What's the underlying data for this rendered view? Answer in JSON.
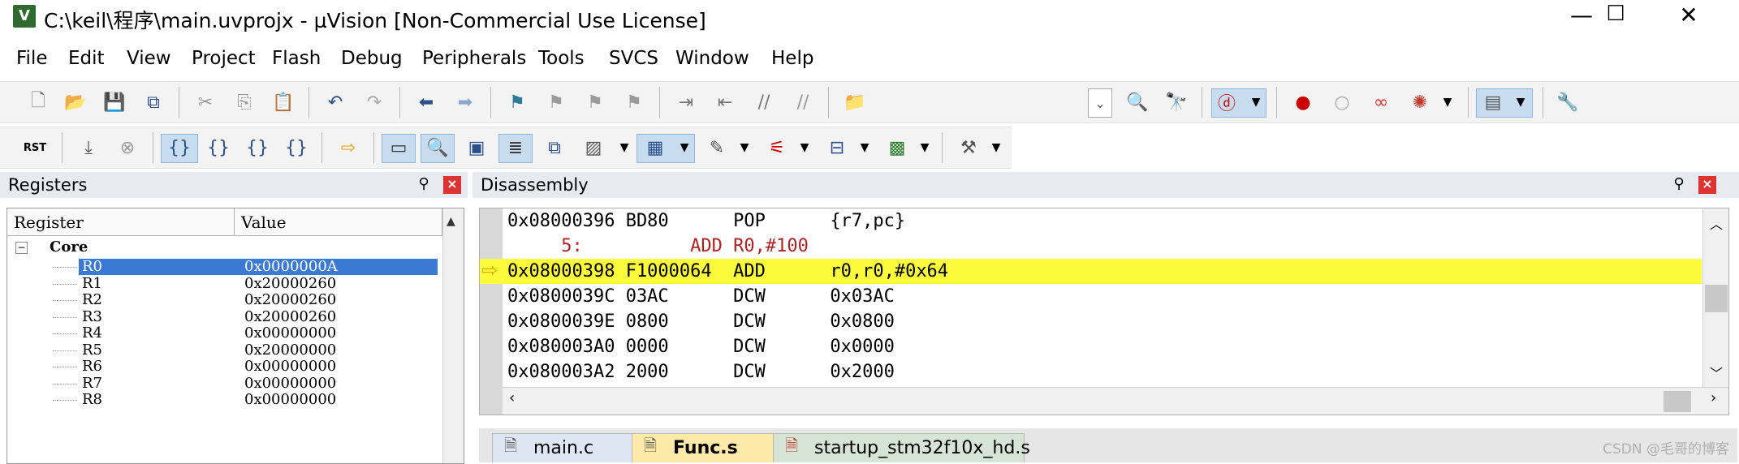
{
  "window": {
    "title": "C:\\keil\\程序\\main.uvprojx - µVision  [Non-Commercial Use License]",
    "icon_label": "V",
    "minimize": "—",
    "maximize": "☐",
    "close": "✕"
  },
  "menu": [
    "File",
    "Edit",
    "View",
    "Project",
    "Flash",
    "Debug",
    "Peripherals",
    "Tools",
    "SVCS",
    "Window",
    "Help"
  ],
  "debug_toolbar": {
    "reset_label": "RST"
  },
  "registers": {
    "title": "Registers",
    "col_register": "Register",
    "col_value": "Value",
    "group": "Core",
    "rows": [
      {
        "name": "R0",
        "value": "0x0000000A"
      },
      {
        "name": "R1",
        "value": "0x20000260"
      },
      {
        "name": "R2",
        "value": "0x20000260"
      },
      {
        "name": "R3",
        "value": "0x20000260"
      },
      {
        "name": "R4",
        "value": "0x00000000"
      },
      {
        "name": "R5",
        "value": "0x20000000"
      },
      {
        "name": "R6",
        "value": "0x00000000"
      },
      {
        "name": "R7",
        "value": "0x00000000"
      },
      {
        "name": "R8",
        "value": "0x00000000"
      }
    ]
  },
  "disassembly": {
    "title": "Disassembly",
    "rows": [
      {
        "text": "0x08000396 BD80      POP      {r7,pc}"
      },
      {
        "text": "     5:          ADD R0,#100"
      },
      {
        "text": "0x08000398 F1000064  ADD      r0,r0,#0x64"
      },
      {
        "text": "0x0800039C 03AC      DCW      0x03AC"
      },
      {
        "text": "0x0800039E 0800      DCW      0x0800"
      },
      {
        "text": "0x080003A0 0000      DCW      0x0000"
      },
      {
        "text": "0x080003A2 2000      DCW      0x2000"
      }
    ]
  },
  "tabs": [
    {
      "label": "main.c"
    },
    {
      "label": "Func.s"
    },
    {
      "label": "startup_stm32f10x_hd.s"
    }
  ],
  "watermark": "CSDN @毛哥的博客"
}
